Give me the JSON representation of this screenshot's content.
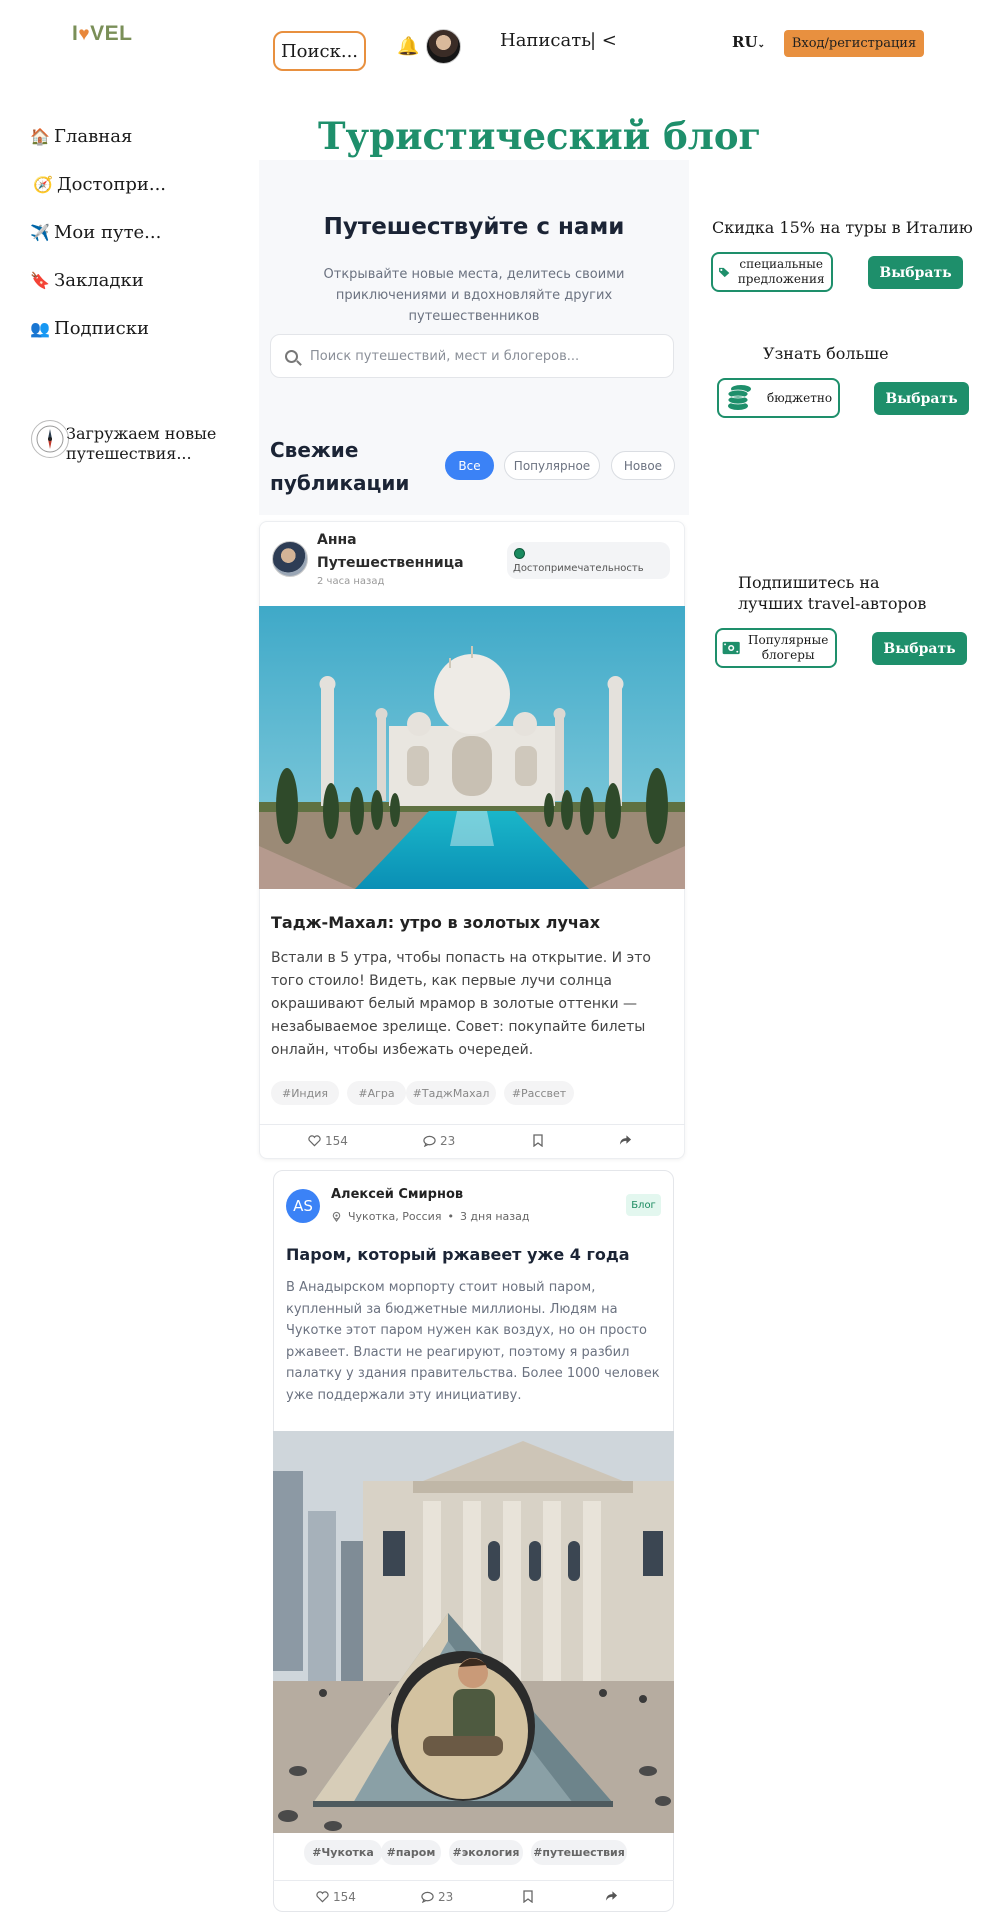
{
  "header": {
    "logo": {
      "pre": "I",
      "heart": "♥",
      "post": "VEL"
    },
    "search_button": "Поиск...",
    "bell_icon": "🔔",
    "write_label": "Написать",
    "collapse_label": "| <",
    "lang": "RU",
    "login_label": "Вход/регистрация"
  },
  "sidebar": {
    "items": [
      {
        "icon": "🏠",
        "label": "Главная"
      },
      {
        "icon": "🧭",
        "label": "Достопри..."
      },
      {
        "icon": "✈️",
        "label": "Мои путе..."
      },
      {
        "icon": "🔖",
        "label": "Закладки"
      },
      {
        "icon": "👥",
        "label": "Подписки"
      }
    ],
    "loading": "Загружаем новые путешествия..."
  },
  "main": {
    "title": "Туристический блог",
    "hero": {
      "heading": "Путешествуйте с нами",
      "text": "Открывайте новые места, делитесь своими приключениями и вдохновляйте других путешественников",
      "search_placeholder": "Поиск путешествий, мест и блогеров..."
    },
    "feed": {
      "heading": "Свежие публикации",
      "filters": [
        "Все",
        "Популярное",
        "Новое"
      ],
      "active_filter": "Все"
    },
    "post1": {
      "author": "Анна Путешественница",
      "time": "2 часа назад",
      "category": "Достопримечательность",
      "title": "Тадж-Махал: утро в золотых лучах",
      "text": "Встали в 5 утра, чтобы попасть на открытие. И это того стоило! Видеть, как первые лучи солнца окрашивают белый мрамор в золотые оттенки — незабываемое зрелище. Совет: покупайте билеты онлайн, чтобы избежать очередей.",
      "tags": [
        "#Индия",
        "#Агра",
        "#ТаджМахал",
        "#Рассвет"
      ],
      "likes": "154",
      "comments": "23"
    },
    "post2": {
      "initials": "AS",
      "author": "Алексей Смирнов",
      "location": "Чукотка, Россия",
      "time": "3 дня назад",
      "badge": "Блог",
      "title": "Паром, который ржавеет уже 4 года",
      "text": "В Анадырском морпорту стоит новый паром, купленный за бюджетные миллионы. Людям на Чукотке этот паром нужен как воздух, но он просто ржавеет. Власти не реагируют, поэтому я разбил палатку у здания правительства. Более 1000 человек уже поддержали эту инициативу.",
      "tags": [
        "#Чукотка",
        "#паром",
        "#экология",
        "#путешествия"
      ],
      "likes": "154",
      "comments": "23"
    }
  },
  "right": {
    "promos": [
      {
        "title": "Скидка 15% на туры в Италию",
        "badge": "специальные предложения",
        "icon": "tag-icon",
        "button": "Выбрать"
      },
      {
        "title": "Узнать больше",
        "badge": "бюджетно",
        "icon": "coins-icon",
        "button": "Выбрать"
      },
      {
        "title": "Подпишитесь на лучших travel-авторов",
        "badge": "Популярные блогеры",
        "icon": "money-icon",
        "button": "Выбрать"
      }
    ]
  },
  "colors": {
    "accent_green": "#1e8f6b",
    "accent_orange": "#e8903f",
    "filter_blue": "#3b82f6"
  }
}
